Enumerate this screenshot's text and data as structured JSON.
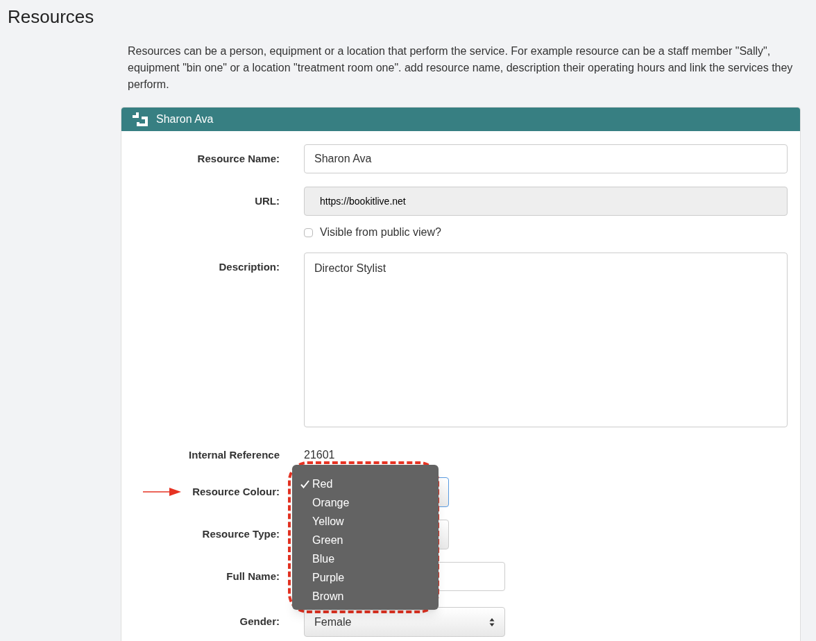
{
  "page": {
    "title": "Resources",
    "intro": "Resources can be a person, equipment or a location that perform the service. For example resource can be a staff member \"Sally\", equipment \"bin one\" or a location \"treatment room one\". add resource name, description their operating hours and link the services they perform."
  },
  "panel": {
    "title": "Sharon Ava"
  },
  "fields": [
    {
      "kind": "text",
      "label": "Resource Name:",
      "value": "Sharon Ava"
    },
    {
      "kind": "readonly",
      "label": "URL:",
      "value": "https://bookitlive.net"
    },
    {
      "kind": "checkbox",
      "label": "Visible from public view?",
      "checked": false
    },
    {
      "kind": "textarea",
      "label": "Description:",
      "value": "Director Stylist"
    },
    {
      "kind": "static",
      "label": "Internal Reference",
      "value": "21601"
    },
    {
      "kind": "select",
      "label": "Resource Colour:",
      "focused": true,
      "annotated": true
    },
    {
      "kind": "select",
      "label": "Resource Type:",
      "focused": false
    },
    {
      "kind": "short_text",
      "label": "Full Name:"
    },
    {
      "kind": "wide_select",
      "label": "Gender:",
      "value": "Female",
      "focused": false
    }
  ],
  "colour_menu": {
    "options": [
      {
        "label": "Red",
        "selected": true
      },
      {
        "label": "Orange",
        "selected": false
      },
      {
        "label": "Yellow",
        "selected": false
      },
      {
        "label": "Green",
        "selected": false
      },
      {
        "label": "Blue",
        "selected": false
      },
      {
        "label": "Purple",
        "selected": false
      },
      {
        "label": "Brown",
        "selected": false
      }
    ]
  }
}
